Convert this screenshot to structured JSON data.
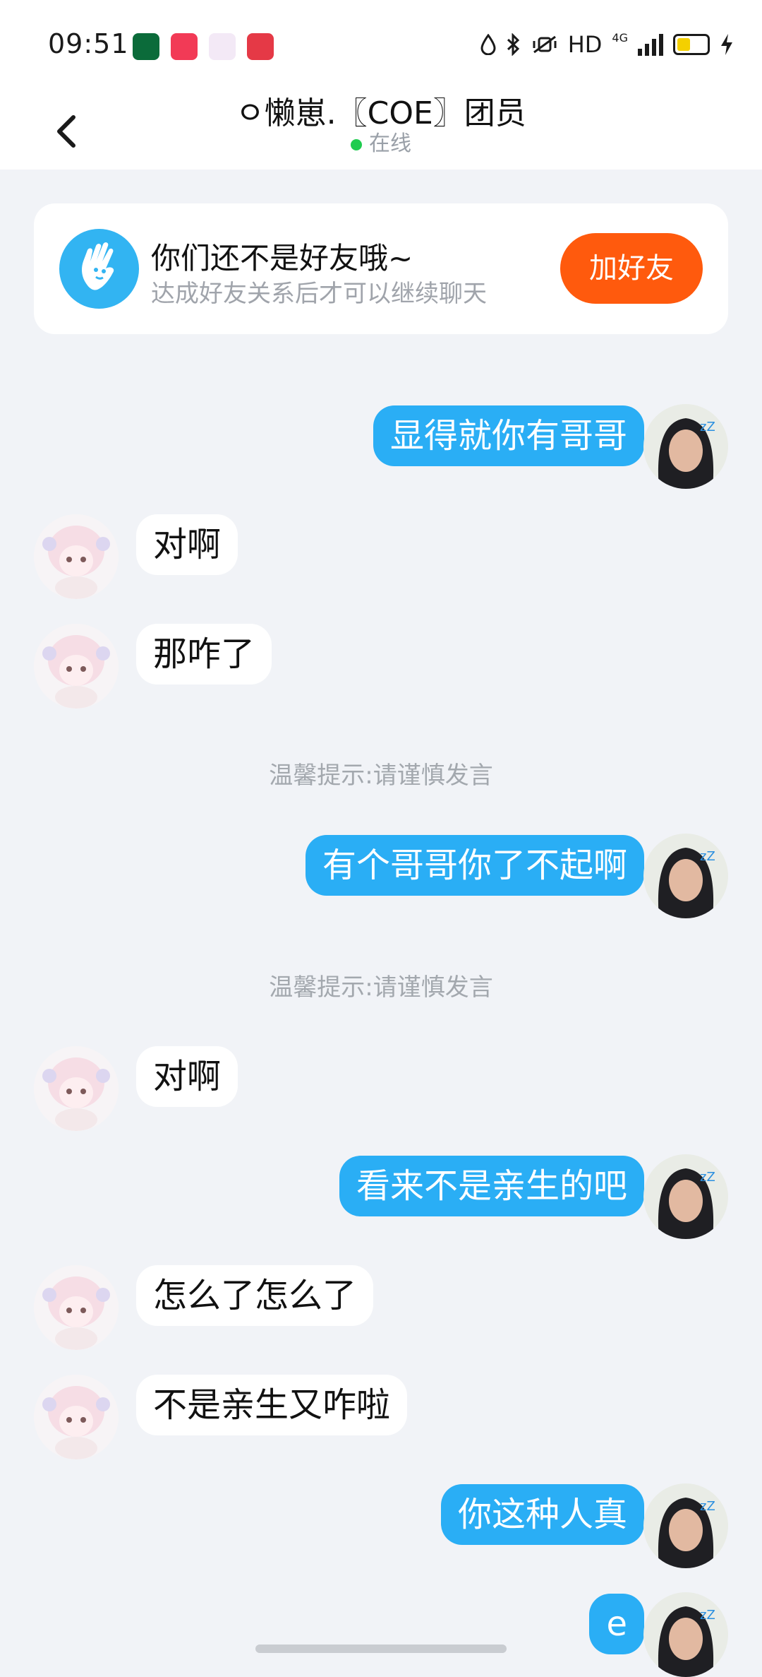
{
  "status_bar": {
    "time": "09:51",
    "network_hd": "HD",
    "network_gen": "4G"
  },
  "header": {
    "title": "ㅇ懒崽.〖COE〗团员",
    "status": "在线"
  },
  "friend_card": {
    "title": "你们还不是好友哦~",
    "subtitle": "达成好友关系后才可以继续聊天",
    "button": "加好友"
  },
  "messages": [
    {
      "side": "out",
      "text": "显得就你有哥哥"
    },
    {
      "side": "in",
      "text": "对啊"
    },
    {
      "side": "in",
      "text": "那咋了"
    },
    {
      "side": "notice",
      "text": "温馨提示:请谨慎发言"
    },
    {
      "side": "out",
      "text": "有个哥哥你了不起啊"
    },
    {
      "side": "notice",
      "text": "温馨提示:请谨慎发言"
    },
    {
      "side": "in",
      "text": "对啊"
    },
    {
      "side": "out",
      "text": "看来不是亲生的吧"
    },
    {
      "side": "in",
      "text": "怎么了怎么了"
    },
    {
      "side": "in",
      "text": "不是亲生又咋啦"
    },
    {
      "side": "out",
      "text": "你这种人真"
    },
    {
      "side": "out",
      "text": "e"
    }
  ],
  "colors": {
    "outgoing_bubble": "#2aaef5",
    "incoming_bubble": "#ffffff",
    "add_button": "#ff5a0d",
    "online_dot": "#1fcc4f",
    "background": "#f1f3f7"
  }
}
